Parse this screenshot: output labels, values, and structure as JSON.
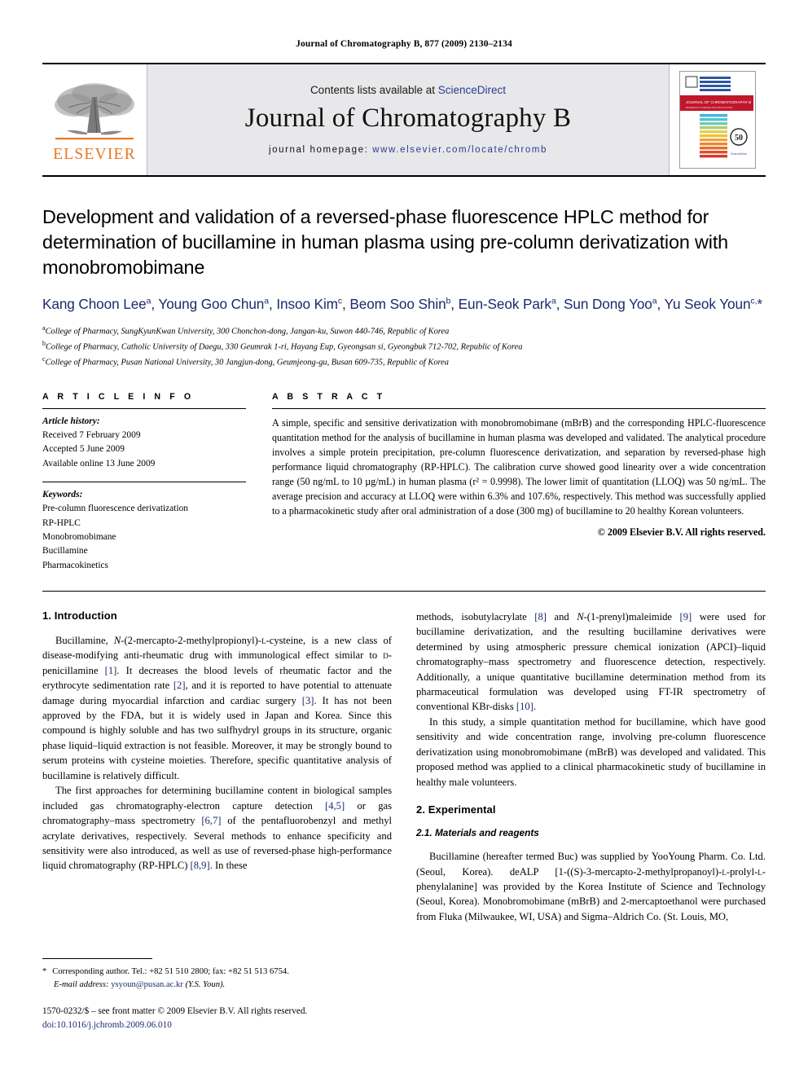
{
  "running_head": "Journal of Chromatography B, 877 (2009) 2130–2134",
  "masthead": {
    "publisher_wordmark": "ELSEVIER",
    "contents_prefix": "Contents lists available at ",
    "contents_link": "ScienceDirect",
    "journal_title": "Journal of Chromatography B",
    "homepage_label": "journal homepage: ",
    "homepage_url": "www.elsevier.com/locate/chromb",
    "cover_band_title": "JOURNAL OF CHROMATOGRAPHY B",
    "cover_seal": "50"
  },
  "article": {
    "title": "Development and validation of a reversed-phase fluorescence HPLC method for determination of bucillamine in human plasma using pre-column derivatization with monobromobimane",
    "authors_html": "Kang Choon Lee<sup>a</sup>, Young Goo Chun<sup>a</sup>, Insoo Kim<sup>c</sup>, Beom Soo Shin<sup>b</sup>, Eun-Seok Park<sup>a</sup>, Sun Dong Yoo<sup>a</sup>, Yu Seok Youn<sup>c,</sup><span class=\"star\">*</span>",
    "affiliations": [
      "College of Pharmacy, SungKyunKwan University, 300 Chonchon-dong, Jangan-ku, Suwon 440-746, Republic of Korea",
      "College of Pharmacy, Catholic University of Daegu, 330 Geumrak 1-ri, Hayang Eup, Gyeongsan si, Gyeongbuk 712-702, Republic of Korea",
      "College of Pharmacy, Pusan National University, 30 Jangjun-dong, Geumjeong-gu, Busan 609-735, Republic of Korea"
    ],
    "affiliation_marks": [
      "a",
      "b",
      "c"
    ]
  },
  "article_info": {
    "heading": "A R T I C L E    I N F O",
    "history_label": "Article history:",
    "history": [
      "Received 7 February 2009",
      "Accepted 5 June 2009",
      "Available online 13 June 2009"
    ],
    "keywords_label": "Keywords:",
    "keywords": [
      "Pre-column fluorescence derivatization",
      "RP-HPLC",
      "Monobromobimane",
      "Bucillamine",
      "Pharmacokinetics"
    ]
  },
  "abstract": {
    "heading": "A B S T R A C T",
    "text": "A simple, specific and sensitive derivatization with monobromobimane (mBrB) and the corresponding HPLC-fluorescence quantitation method for the analysis of bucillamine in human plasma was developed and validated. The analytical procedure involves a simple protein precipitation, pre-column fluorescence derivatization, and separation by reversed-phase high performance liquid chromatography (RP-HPLC). The calibration curve showed good linearity over a wide concentration range (50 ng/mL to 10 µg/mL) in human plasma (r² = 0.9998). The lower limit of quantitation (LLOQ) was 50 ng/mL. The average precision and accuracy at LLOQ were within 6.3% and 107.6%, respectively. This method was successfully applied to a pharmacokinetic study after oral administration of a dose (300 mg) of bucillamine to 20 healthy Korean volunteers.",
    "copyright": "© 2009 Elsevier B.V. All rights reserved."
  },
  "body": {
    "intro_heading": "1.  Introduction",
    "intro_p1_html": "Bucillamine, <i>N</i>-(2-mercapto-2-methylpropionyl)-<span class=\"sc\">l</span>-cysteine, is a new class of disease-modifying anti-rheumatic drug with immunological effect similar to <span class=\"sc\">d</span>-penicillamine <span class=\"cit\">[1]</span>. It decreases the blood levels of rheumatic factor and the erythrocyte sedimentation rate <span class=\"cit\">[2]</span>, and it is reported to have potential to attenuate damage during myocardial infarction and cardiac surgery <span class=\"cit\">[3]</span>. It has not been approved by the FDA, but it is widely used in Japan and Korea. Since this compound is highly soluble and has two sulfhydryl groups in its structure, organic phase liquid–liquid extraction is not feasible. Moreover, it may be strongly bound to serum proteins with cysteine moieties. Therefore, specific quantitative analysis of bucillamine is relatively difficult.",
    "intro_p2_html": "The first approaches for determining bucillamine content in biological samples included gas chromatography-electron capture detection <span class=\"cit\">[4,5]</span> or gas chromatography–mass spectrometry <span class=\"cit\">[6,7]</span> of the pentafluorobenzyl and methyl acrylate derivatives, respectively. Several methods to enhance specificity and sensitivity were also introduced, as well as use of reversed-phase high-performance liquid chromatography (RP-HPLC) <span class=\"cit\">[8,9]</span>. In these",
    "intro_p3_html": "methods, isobutylacrylate <span class=\"cit\">[8]</span> and <i>N</i>-(1-prenyl)maleimide <span class=\"cit\">[9]</span> were used for bucillamine derivatization, and the resulting bucillamine derivatives were determined by using atmospheric pressure chemical ionization (APCI)–liquid chromatography–mass spectrometry and fluorescence detection, respectively. Additionally, a unique quantitative bucillamine determination method from its pharmaceutical formulation was developed using FT-IR spectrometry of conventional KBr-disks <span class=\"cit\">[10]</span>.",
    "intro_p4_html": "In this study, a simple quantitation method for bucillamine, which have good sensitivity and wide concentration range, involving pre-column fluorescence derivatization using monobromobimane (mBrB) was developed and validated. This proposed method was applied to a clinical pharmacokinetic study of bucillamine in healthy male volunteers.",
    "exp_heading": "2.  Experimental",
    "exp_subheading": "2.1.  Materials and reagents",
    "exp_p1_html": "Bucillamine (hereafter termed Buc) was supplied by YooYoung Pharm. Co. Ltd. (Seoul, Korea). deALP [1-((S)-3-mercapto-2-methylpropanoyl)-<span class=\"sc\">l</span>-prolyl-<span class=\"sc\">l</span>-phenylalanine] was provided by the Korea Institute of Science and Technology (Seoul, Korea). Monobromobimane (mBrB) and 2-mercaptoethanol were purchased from Fluka (Milwaukee, WI, USA) and Sigma–Aldrich Co. (St. Louis, MO,"
  },
  "footnote": {
    "star": "*",
    "corresponding": "Corresponding author. Tel.: +82 51 510 2800; fax: +82 51 513 6754.",
    "email_label": "E-mail address: ",
    "email": "ysyoun@pusan.ac.kr",
    "email_suffix": " (Y.S. Youn).",
    "issn_line": "1570-0232/$ – see front matter © 2009 Elsevier B.V. All rights reserved.",
    "doi_line": "doi:10.1016/j.jchromb.2009.06.010"
  },
  "colors": {
    "elsevier_orange": "#E87722",
    "link_blue": "#2a3b8f",
    "citation_blue": "#1b2a6b",
    "masthead_grey": "#e8e8ea"
  }
}
